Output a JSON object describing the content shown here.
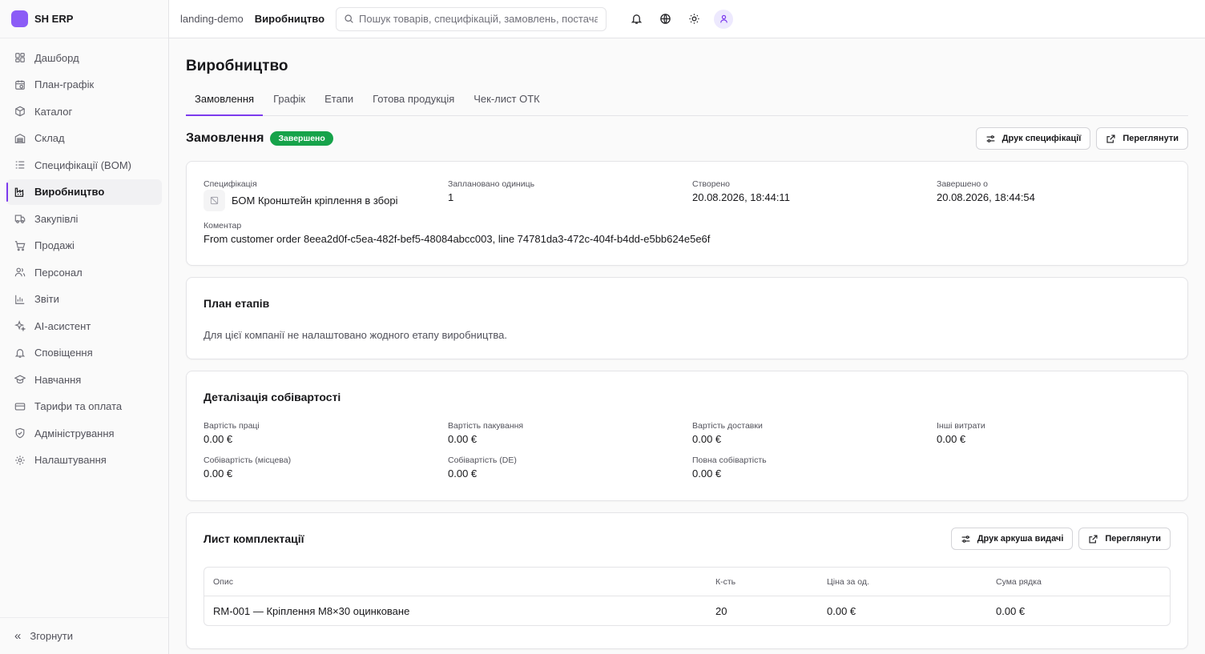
{
  "app": {
    "brand": "SH ERP"
  },
  "sidebar": {
    "items": [
      {
        "label": "Дашборд",
        "icon": "dashboard-icon"
      },
      {
        "label": "План-графік",
        "icon": "calendar-icon"
      },
      {
        "label": "Каталог",
        "icon": "package-icon"
      },
      {
        "label": "Склад",
        "icon": "warehouse-icon"
      },
      {
        "label": "Специфікації (BOM)",
        "icon": "list-icon"
      },
      {
        "label": "Виробництво",
        "icon": "factory-icon",
        "active": true
      },
      {
        "label": "Закупівлі",
        "icon": "truck-icon"
      },
      {
        "label": "Продажі",
        "icon": "cart-icon"
      },
      {
        "label": "Персонал",
        "icon": "users-icon"
      },
      {
        "label": "Звіти",
        "icon": "chart-icon"
      },
      {
        "label": "AI-асистент",
        "icon": "sparkles-icon"
      },
      {
        "label": "Сповіщення",
        "icon": "bell-icon"
      },
      {
        "label": "Навчання",
        "icon": "graduation-cap-icon"
      },
      {
        "label": "Тарифи та оплата",
        "icon": "credit-card-icon"
      },
      {
        "label": "Адміністрування",
        "icon": "shield-icon"
      },
      {
        "label": "Налаштування",
        "icon": "gear-icon"
      }
    ],
    "collapse_label": "Згорнути"
  },
  "topbar": {
    "breadcrumb_org": "landing-demo",
    "breadcrumb_current": "Виробництво",
    "search_placeholder": "Пошук товарів, специфікацій, замовлень, постачальників"
  },
  "page": {
    "title": "Виробництво",
    "tabs": [
      {
        "label": "Замовлення",
        "active": true
      },
      {
        "label": "Графік"
      },
      {
        "label": "Етапи"
      },
      {
        "label": "Готова продукція"
      },
      {
        "label": "Чек-лист ОТК"
      }
    ]
  },
  "order": {
    "title": "Замовлення",
    "status": "Завершено",
    "status_color": "#16a34a",
    "print_spec_label": "Друк специфікації",
    "view_label": "Переглянути",
    "spec_label": "Специфікація",
    "spec_value": "БОМ Кронштейн кріплення в зборі",
    "planned_label": "Заплановано одиниць",
    "planned_value": "1",
    "created_label": "Створено",
    "created_value": "20.08.2026, 18:44:11",
    "completed_label": "Завершено о",
    "completed_value": "20.08.2026, 18:44:54",
    "comment_label": "Коментар",
    "comment_value": "From customer order 8eea2d0f-c5ea-482f-bef5-48084abcc003, line 74781da3-472c-404f-b4dd-e5bb624e5e6f"
  },
  "stages": {
    "title": "План етапів",
    "empty_text": "Для цієї компанії не налаштовано жодного етапу виробництва."
  },
  "costs": {
    "title": "Деталізація собівартості",
    "items": [
      {
        "label": "Вартість праці",
        "value": "0.00 €"
      },
      {
        "label": "Вартість пакування",
        "value": "0.00 €"
      },
      {
        "label": "Вартість доставки",
        "value": "0.00 €"
      },
      {
        "label": "Інші витрати",
        "value": "0.00 €"
      },
      {
        "label": "Собівартість (місцева)",
        "value": "0.00 €"
      },
      {
        "label": "Собівартість (DE)",
        "value": "0.00 €"
      },
      {
        "label": "Повна собівартість",
        "value": "0.00 €"
      }
    ]
  },
  "picklist": {
    "title": "Лист комплектації",
    "print_label": "Друк аркуша видачі",
    "view_label": "Переглянути",
    "columns": [
      "Опис",
      "К-сть",
      "Ціна за од.",
      "Сума рядка"
    ],
    "rows": [
      [
        "RM-001 — Кріплення M8×30 оцинковане",
        "20",
        "0.00 €",
        "0.00 €"
      ]
    ]
  },
  "colors": {
    "accent": "#7c3aed",
    "brand": "#8b5cf6",
    "success": "#16a34a"
  }
}
